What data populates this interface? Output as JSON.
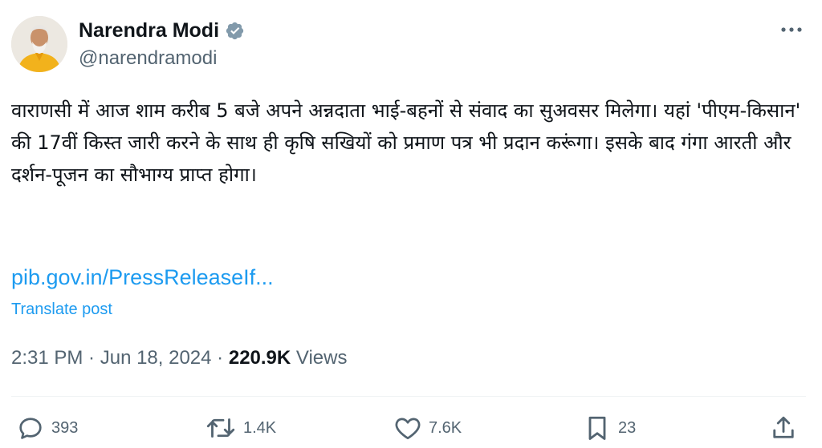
{
  "author": {
    "display_name": "Narendra Modi",
    "handle": "@narendramodi",
    "avatar_icon": "profile-photo",
    "verified_color": "#829aab"
  },
  "more_icon": "more-horizontal-icon",
  "tweet": {
    "text": "वाराणसी में आज शाम करीब 5 बजे अपने अन्नदाता भाई-बहनों से संवाद का सुअवसर मिलेगा। यहां 'पीएम-किसान' की 17वीं किस्त जारी करने के साथ ही कृषि सखियों को प्रमाण पत्र भी प्रदान करूंगा। इसके बाद गंगा आरती और दर्शन-पूजन का सौभाग्य प्राप्त होगा।",
    "link": "pib.gov.in/PressReleaseIf...",
    "translate": "Translate post"
  },
  "meta": {
    "time": "2:31 PM",
    "sep1": " · ",
    "date": "Jun 18, 2024",
    "sep2": " · ",
    "views_count": "220.9K",
    "views_label": " Views"
  },
  "actions": {
    "replies": "393",
    "reposts": "1.4K",
    "likes": "7.6K",
    "bookmarks": "23"
  },
  "colors": {
    "link": "#1d9bf0",
    "secondary_text": "#536471",
    "primary_text": "#0f1419"
  }
}
